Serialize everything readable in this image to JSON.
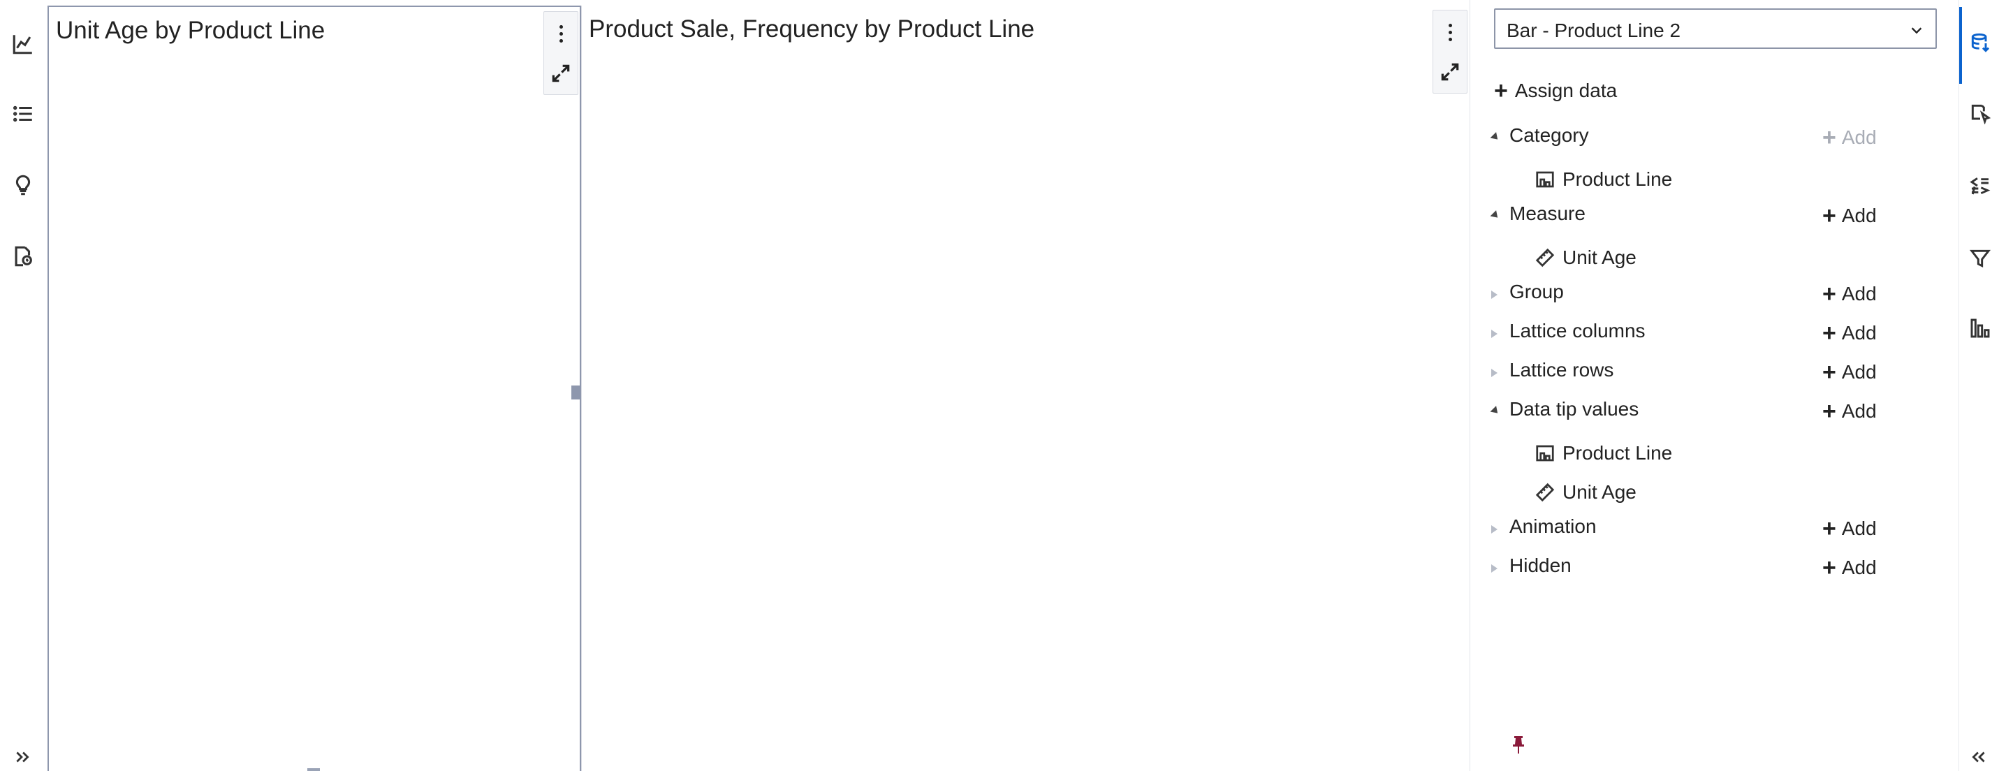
{
  "left_rail": {
    "icons": [
      "line-chart-icon",
      "list-icon",
      "lightbulb-icon",
      "report-settings-icon"
    ],
    "expand_icon": "double-chevron-right-icon"
  },
  "canvas": {
    "objects": [
      {
        "title": "Unit Age by Product Line",
        "menu_icon": "kebab-icon",
        "maximize_icon": "maximize-icon"
      },
      {
        "title": "Product Sale, Frequency by Product Line",
        "menu_icon": "kebab-icon",
        "maximize_icon": "maximize-icon"
      }
    ]
  },
  "data_pane": {
    "object_selector": "Bar - Product Line 2",
    "assign_data_label": "Assign data",
    "add_label": "Add",
    "roles": [
      {
        "label": "Category",
        "expanded": true,
        "add_enabled": false,
        "items": [
          {
            "label": "Product Line",
            "icon": "category-icon"
          }
        ]
      },
      {
        "label": "Measure",
        "expanded": true,
        "add_enabled": true,
        "items": [
          {
            "label": "Unit Age",
            "icon": "measure-icon"
          }
        ]
      },
      {
        "label": "Group",
        "expanded": false,
        "add_enabled": true,
        "items": []
      },
      {
        "label": "Lattice columns",
        "expanded": false,
        "add_enabled": true,
        "items": []
      },
      {
        "label": "Lattice rows",
        "expanded": false,
        "add_enabled": true,
        "items": []
      },
      {
        "label": "Data tip values",
        "expanded": true,
        "add_enabled": true,
        "items": [
          {
            "label": "Product Line",
            "icon": "category-icon"
          },
          {
            "label": "Unit Age",
            "icon": "measure-icon"
          }
        ]
      },
      {
        "label": "Animation",
        "expanded": false,
        "add_enabled": true,
        "items": []
      },
      {
        "label": "Hidden",
        "expanded": false,
        "add_enabled": true,
        "items": []
      }
    ],
    "pin_icon": "pin-icon"
  },
  "right_rail": {
    "icons": [
      "data-icon",
      "options-icon",
      "rules-icon",
      "filter-icon",
      "ranks-icon"
    ],
    "active": "data-icon",
    "collapse_icon": "double-chevron-left-icon"
  },
  "colors": {
    "accent": "#0b63ce",
    "panel_border": "#8e97ad",
    "pin": "#8a1a3a"
  }
}
